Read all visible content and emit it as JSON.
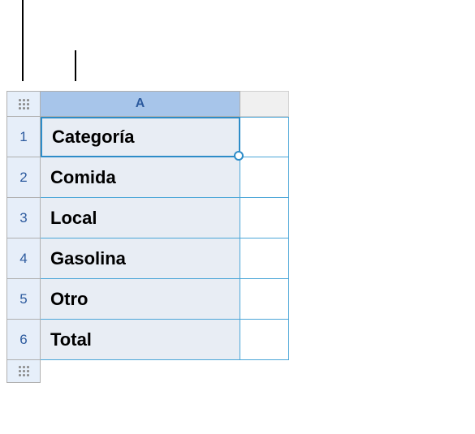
{
  "columns": {
    "a": "A"
  },
  "rows": [
    {
      "num": "1",
      "value": "Categoría",
      "selected": true
    },
    {
      "num": "2",
      "value": "Comida",
      "selected": false
    },
    {
      "num": "3",
      "value": "Local",
      "selected": false
    },
    {
      "num": "4",
      "value": "Gasolina",
      "selected": false
    },
    {
      "num": "5",
      "value": "Otro",
      "selected": false
    },
    {
      "num": "6",
      "value": "Total",
      "selected": false
    }
  ]
}
